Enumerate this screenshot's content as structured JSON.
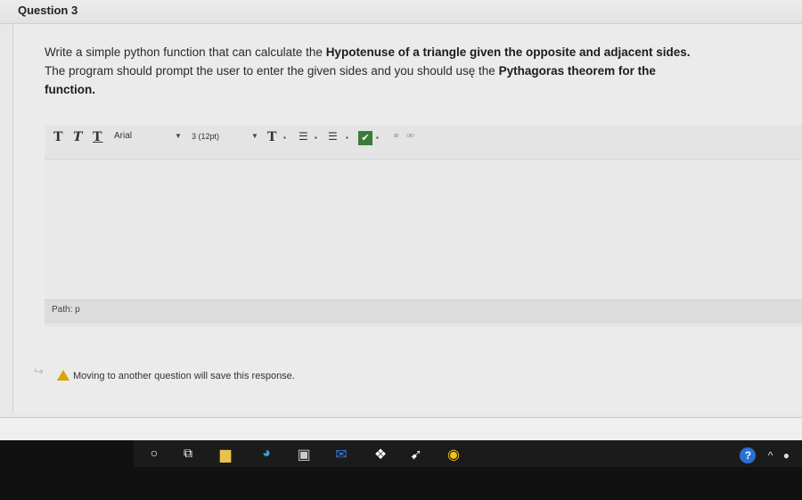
{
  "question": {
    "title": "Question 3",
    "prompt": {
      "p1": "Write a simple python function that can calculate the ",
      "b1": "Hypotenuse of a triangle given the opposite and adjacent sides.",
      "p2": "The program should prompt the user to  enter the given sides and you should usę the ",
      "b2": "Pythagoras theorem for the",
      "b3": "function."
    }
  },
  "editor": {
    "font": "Arial",
    "size": "3 (12pt)",
    "path": "Path: p"
  },
  "warning": "Moving to another question will save this response.",
  "taskbar": {
    "icons": [
      "search-icon",
      "task-view-icon",
      "file-explorer-icon",
      "edge-icon",
      "store-icon",
      "mail-icon",
      "dropbox-icon",
      "app-icon",
      "chrome-icon"
    ]
  }
}
